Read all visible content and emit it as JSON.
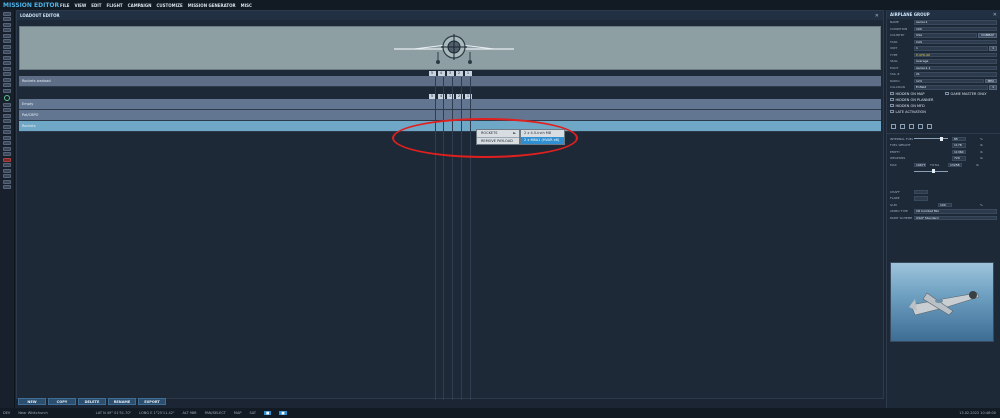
{
  "app": {
    "title": "MISSION EDITOR"
  },
  "menu": [
    "FILE",
    "VIEW",
    "EDIT",
    "FLIGHT",
    "CAMPAIGN",
    "CUSTOMIZE",
    "MISSION GENERATOR",
    "MISC"
  ],
  "loadout": {
    "title": "LOADOUT EDITOR",
    "close": "✕",
    "pylon_numbers": [
      "5",
      "4",
      "3",
      "2",
      "1"
    ],
    "rows": [
      {
        "label": "Rockets warload"
      },
      {
        "label": "Empty"
      },
      {
        "label": "Pat/CBPO"
      },
      {
        "label": "Rockets"
      }
    ]
  },
  "context_menu": {
    "items": [
      "ROCKETS",
      "REMOVE PAYLOAD"
    ],
    "arrow": "►",
    "submenu": [
      "2 x 4.5-inch M8",
      "2 x M8A1 (HVAR x6)"
    ]
  },
  "bottom_buttons": [
    "NEW",
    "COPY",
    "DELETE",
    "RENAME",
    "EXPORT"
  ],
  "statusbar": {
    "map": "DEV",
    "location": "Near Whitchurch",
    "lat": "LAT  N 49° 01'51.70\"",
    "long": "LONG  E 1°25'11.42\"",
    "alt": "ALT  98ft",
    "mode": "PAN/SELECT",
    "m1": "MAP",
    "m2": "SAT",
    "datetime": "13.02.2022 10:46:00"
  },
  "airplane_group": {
    "title": "AIRPLANE GROUP",
    "close": "✕",
    "fields": [
      {
        "label": "NAME",
        "value": "Aerial-1"
      },
      {
        "label": "CONDITION",
        "value": "100"
      },
      {
        "label": "COUNTRY",
        "value": "USA",
        "button": "COMBAT"
      },
      {
        "label": "TASK",
        "value": "CAS"
      },
      {
        "label": "UNIT",
        "value": "1",
        "button": "1"
      },
      {
        "label": "TYPE",
        "value": "P-47D-40",
        "highlight": true
      },
      {
        "label": "SKILL",
        "value": "Average"
      },
      {
        "label": "PILOT",
        "value": "Aerial-1-1"
      },
      {
        "label": "TAIL #",
        "value": "21"
      },
      {
        "label": "RADIO",
        "value": "124",
        "button": "MHz"
      },
      {
        "label": "CALLSIGN",
        "value": "Enfield",
        "button": "1"
      }
    ],
    "checks": [
      "HIDDEN ON MAP",
      "GAME MASTER ONLY",
      "HIDDEN ON PLANNER",
      "HIDDEN ON MFD",
      "LATE ACTIVATION"
    ],
    "sliders": [
      {
        "label": "INTERNAL FUEL",
        "value": "85",
        "unit": "%"
      },
      {
        "label": "FUEL WEIGHT",
        "value": "1178",
        "unit": "lb"
      },
      {
        "label": "EMPTY",
        "value": "11360",
        "unit": "lb"
      },
      {
        "label": "WEAPONS",
        "value": "720",
        "unit": "lb"
      },
      {
        "label": "MAX",
        "value": "19677",
        "unit": "lb"
      },
      {
        "label": "TOTAL",
        "value": "13258",
        "unit": "lb"
      }
    ],
    "extras": [
      {
        "label": "CHAFF",
        "value": ""
      },
      {
        "label": "FLARE",
        "value": ""
      },
      {
        "label": "GUN",
        "value": "100",
        "unit": "%"
      },
      {
        "label": "AMMO TYPE",
        "value": "CR Combat Mix"
      },
      {
        "label": "PAINT SCHEME",
        "value": "USAF Standard"
      }
    ]
  }
}
